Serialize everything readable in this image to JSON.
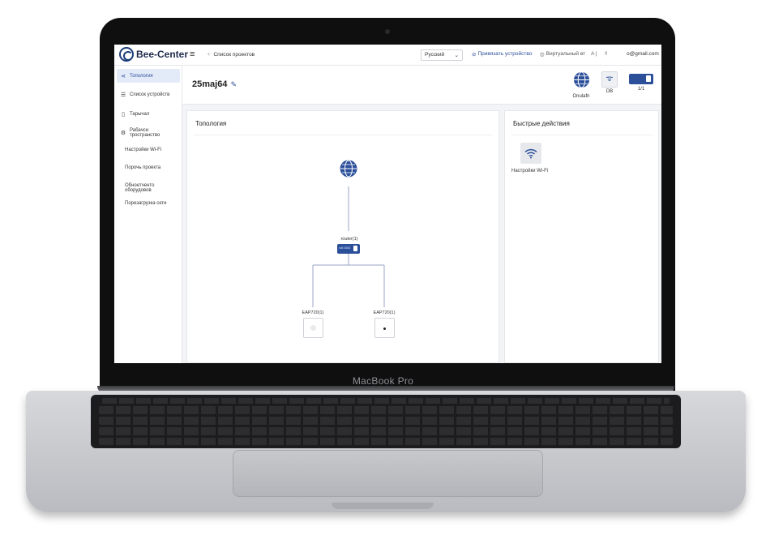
{
  "device_label": "MacBook Pro",
  "app": {
    "brand": "Bee-Center",
    "nav_menu_icon": "hamburger-icon",
    "projects_link": "Список проектов",
    "language": "Русский",
    "bind_device": "Привязать устройство",
    "virtual": "Виртуальный вт",
    "font_indicator": "A",
    "separator": "|",
    "lock_label": "!!",
    "email": "o@gmail.com"
  },
  "sidebar": {
    "items": [
      {
        "label": "Топология",
        "icon": "topology-icon",
        "active": true
      },
      {
        "label": "Список устройств",
        "icon": "list-icon",
        "active": false
      },
      {
        "label": "Тарычал",
        "icon": "device-icon",
        "active": false
      },
      {
        "label": "Рабачси тространство",
        "icon": "gear-icon",
        "active": false
      }
    ],
    "subitems": [
      "Настройки Wi-Fi",
      "Порочь проекта",
      "Обноетченто оборудовов",
      "Порезагрузка сети"
    ]
  },
  "header": {
    "project_name": "25maj64",
    "stats": [
      {
        "label": "Onulafn",
        "icon": "globe-icon"
      },
      {
        "label": "DB",
        "icon": "wifi-icon"
      },
      {
        "label": "1/1",
        "icon": "router-icon"
      }
    ]
  },
  "topology": {
    "title": "Топология",
    "router_label": "router(1)",
    "router_small_text": "ruB 0608",
    "ap_left_label": "EAP720(1)",
    "ap_right_label": "EAP720(1)"
  },
  "quick_actions": {
    "title": "Быстрые действия",
    "items": [
      {
        "label": "Настройки Wi-Fi",
        "icon": "wifi-icon"
      }
    ]
  },
  "colors": {
    "accent": "#2c4f9a",
    "active_bg": "#e3ebf8",
    "line": "#9aa5c6"
  }
}
